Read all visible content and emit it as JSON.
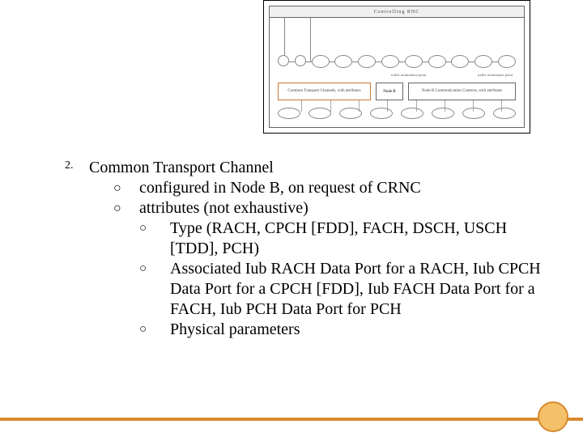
{
  "diagram": {
    "header": "Controlling RNC",
    "common_box": "Common Transport Channels, with attributes",
    "nodeb": "Node B",
    "commctx": "Node B Communication Contexts, with attributes",
    "term_left": "traffic termination point",
    "term_right": "traffic termination point",
    "top_ellipses": [
      "",
      "",
      "",
      "",
      "",
      "",
      "",
      "",
      "",
      "",
      ""
    ],
    "bot_ellipses": [
      "",
      "",
      "",
      "",
      "",
      "",
      "",
      ""
    ]
  },
  "item_number": "2.",
  "title": "Common Transport Channel",
  "sub": [
    "configured in Node B, on request of CRNC",
    "attributes (not exhaustive)"
  ],
  "subsub": [
    "Type (RACH, CPCH [FDD], FACH, DSCH, USCH [TDD], PCH)",
    "Associated Iub RACH Data Port for a RACH, Iub CPCH Data Port for a CPCH [FDD], Iub FACH Data Port for a FACH, Iub PCH Data Port for PCH",
    "Physical parameters"
  ],
  "bullet_glyph": "○"
}
